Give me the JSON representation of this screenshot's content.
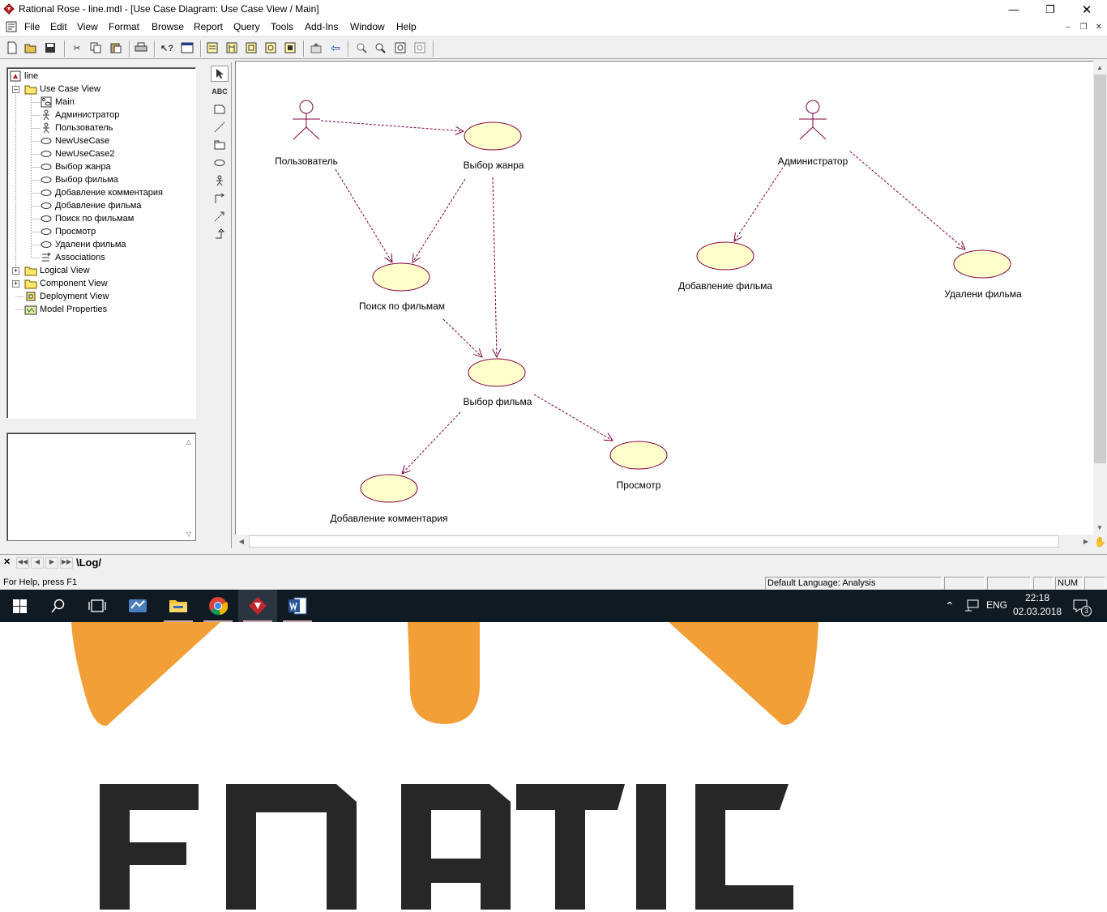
{
  "window": {
    "title": "Rational Rose - line.mdl - [Use Case Diagram: Use Case View / Main]"
  },
  "menu": [
    "File",
    "Edit",
    "View",
    "Format",
    "Browse",
    "Report",
    "Query",
    "Tools",
    "Add-Ins",
    "Window",
    "Help"
  ],
  "tree": {
    "root": "line",
    "use_case_view": "Use Case View",
    "children": [
      "Main",
      "Администратор",
      "Пользователь",
      "NewUseCase",
      "NewUseCase2",
      "Выбор жанра",
      "Выбор фильма",
      "Добавление комментария",
      "Добавление фильма",
      "Поиск по фильмам",
      "Просмотр",
      "Удалени фильма",
      "Associations"
    ],
    "logical_view": "Logical View",
    "component_view": "Component View",
    "deployment_view": "Deployment View",
    "model_properties": "Model Properties"
  },
  "diagram": {
    "actor_user": "Пользователь",
    "actor_admin": "Администратор",
    "uc_genre": "Выбор жанра",
    "uc_search": "Поиск по фильмам",
    "uc_choose": "Выбор фильма",
    "uc_comment": "Добавление комментария",
    "uc_view": "Просмотр",
    "uc_add": "Добавление фильма",
    "uc_delete": "Удалени фильма"
  },
  "tools_text": {
    "abc": "ABC"
  },
  "log_tab": "\\Log/",
  "status": {
    "help": "For Help, press F1",
    "language": "Default Language: Analysis",
    "num": "NUM"
  },
  "taskbar": {
    "lang": "ENG",
    "time": "22:18",
    "date": "02.03.2018",
    "notifications": "3"
  },
  "background": {
    "logo_text": "FNATIC"
  },
  "colors": {
    "usecase_fill": "#ffffcc",
    "line": "#800040",
    "logo_dark": "#272727",
    "logo_orange": "#f29f38"
  }
}
